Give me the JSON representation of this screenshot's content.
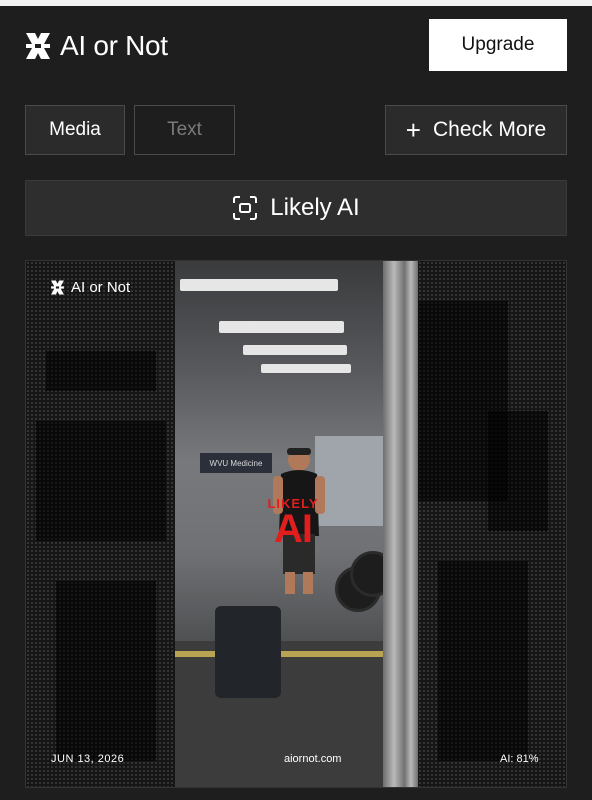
{
  "header": {
    "app_name": "AI or Not",
    "upgrade_label": "Upgrade"
  },
  "tabs": [
    {
      "label": "Media",
      "active": true
    },
    {
      "label": "Text",
      "active": false
    }
  ],
  "check_more_label": "Check More",
  "verdict": {
    "label": "Likely AI",
    "icon": "scan-icon"
  },
  "image_card": {
    "watermark_logo_text": "AI or Not",
    "stamp_small": "LIKELY",
    "stamp_big": "AI",
    "photo_banner": "WVU Medicine",
    "footer_date": "JUN 13, 2026",
    "footer_site": "aiornot.com",
    "footer_score": "AI: 81%"
  },
  "colors": {
    "background": "#1e1e1e",
    "stamp_red": "#e01e1e",
    "upgrade_bg": "#ffffff"
  }
}
